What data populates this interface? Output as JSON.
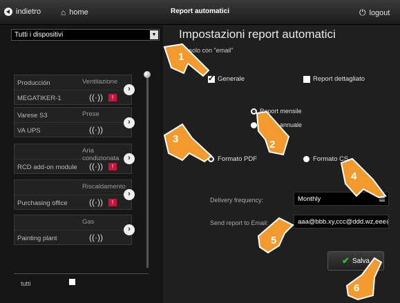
{
  "topbar": {
    "back_label": "indietro",
    "home_label": "home",
    "title": "Report automatici",
    "logout_label": "logout"
  },
  "sidebar": {
    "filter_value": "Tutti i dispositivi",
    "devices": [
      {
        "name": "Producción",
        "category": "Ventilazione",
        "sub": "MEGATIKER-1",
        "alert": "!"
      },
      {
        "name": "Varese S3",
        "category": "Prese",
        "sub": "VA UPS",
        "alert": ""
      },
      {
        "name": "",
        "category": "Aria condizionata",
        "sub": "RCD add-on module",
        "alert": "!"
      },
      {
        "name": "",
        "category": "Riscaldamento",
        "sub": "Purchasing office",
        "alert": "!"
      },
      {
        "name": "",
        "category": "Gas",
        "sub": "Painting plant",
        "alert": ""
      }
    ],
    "all_label": "tutti"
  },
  "main": {
    "heading": "Impostazioni report automatici",
    "subtitle": "ile solo con \"email\"",
    "generale_label": "Generale",
    "dettagliato_label": "Report dettagliato",
    "mensile_label": "Report mensile",
    "annuale_label": "annuale",
    "pdf_label": "Formato PDF",
    "csv_label": "Formato CS",
    "delivery_label": "Delivery frequency:",
    "delivery_value": "Monthly",
    "email_label": "Send report to Email:",
    "email_value": "aaa@bbb.xy,ccc@ddd.wz,eee@",
    "save_label": "Salva"
  },
  "callouts": [
    "1",
    "2",
    "3",
    "4",
    "5",
    "6"
  ],
  "colors": {
    "accent_orange": "#f29a2e",
    "alert_red": "#c8143c",
    "save_green": "#2fbf3a"
  }
}
